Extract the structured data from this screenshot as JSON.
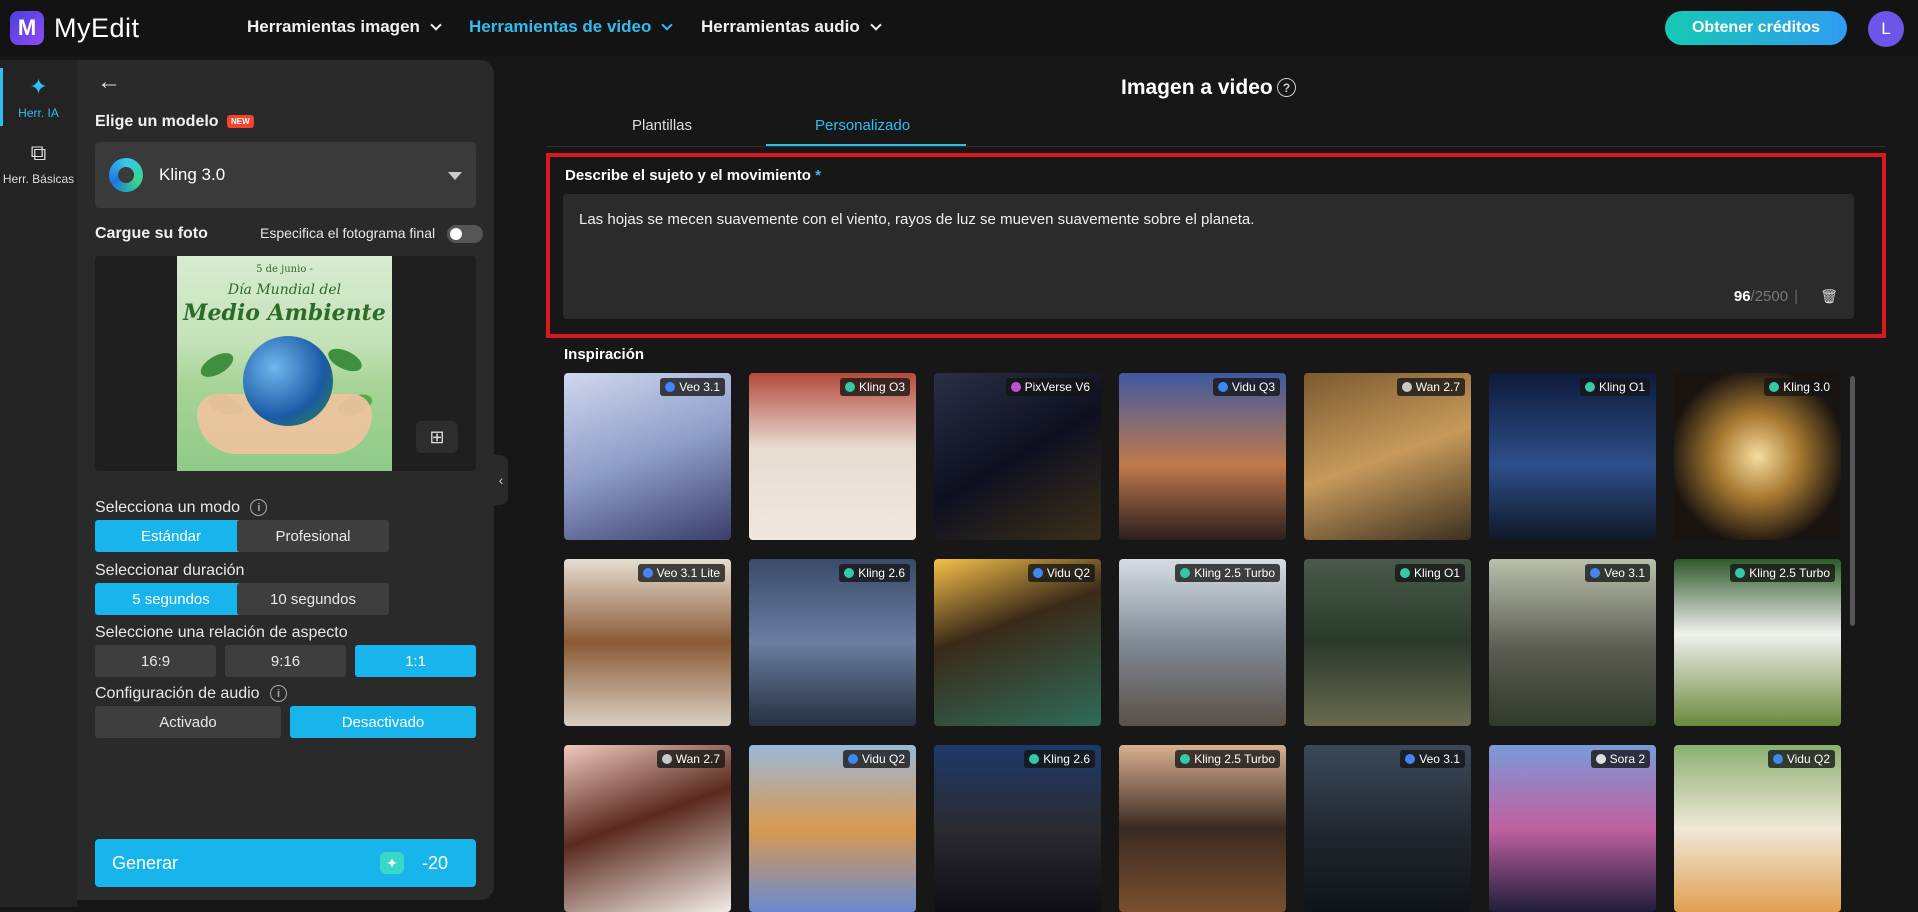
{
  "app": {
    "name": "MyEdit",
    "logo_letter": "M"
  },
  "nav": {
    "items": [
      {
        "label": "Herramientas imagen",
        "active": false
      },
      {
        "label": "Herramientas de video",
        "active": true
      },
      {
        "label": "Herramientas audio",
        "active": false
      }
    ],
    "credits_label": "Obtener créditos",
    "avatar_letter": "L"
  },
  "rail": {
    "items": [
      {
        "label": "Herr. IA",
        "icon": "magic-wand-icon",
        "active": true
      },
      {
        "label": "Herr. Básicas",
        "icon": "layers-icon",
        "active": false
      }
    ]
  },
  "panel": {
    "model_label": "Elige un modelo",
    "new_badge": "NEW",
    "model_selected": "Kling 3.0",
    "upload_label": "Cargue su foto",
    "final_frame_label": "Especifica el fotograma final",
    "photo_line1": "5 de junio -",
    "photo_line2": "Día Mundial del",
    "photo_line3": "Medio Ambiente",
    "mode_label": "Selecciona un modo",
    "modes": [
      "Estándar",
      "Profesional"
    ],
    "duration_label": "Seleccionar duración",
    "durations": [
      "5 segundos",
      "10 segundos"
    ],
    "aspect_label": "Seleccione una relación de aspecto",
    "aspects": [
      "16:9",
      "9:16",
      "1:1"
    ],
    "audio_label": "Configuración de audio",
    "audio_options": [
      "Activado",
      "Desactivado"
    ],
    "generate_label": "Generar",
    "generate_cost": "-20"
  },
  "main": {
    "title": "Imagen a video",
    "tabs": [
      "Plantillas",
      "Personalizado"
    ],
    "prompt_label": "Describe el sujeto y el movimiento",
    "prompt_required": "*",
    "prompt_text": "Las hojas se mecen suavemente con el viento, rayos de luz se mueven suavemente sobre el planeta.",
    "count_current": "96",
    "count_max": "/2500",
    "count_sep": "|",
    "inspiration_label": "Inspiración",
    "cards": [
      {
        "tag": "Veo 3.1",
        "bg": "linear-gradient(160deg,#cfd8ec,#8e9cc8 50%,#3a3e6a)"
      },
      {
        "tag": "Kling O3",
        "bg": "linear-gradient(180deg,#b54a3a,#e6dcd2 45%,#f0e8e0)"
      },
      {
        "tag": "PixVerse V6",
        "bg": "linear-gradient(150deg,#2a2f45,#0e1020 50%,#3b2f18)"
      },
      {
        "tag": "Vidu Q3",
        "bg": "linear-gradient(180deg,#3e5aa0,#c07a4a 55%,#2a1f1f)"
      },
      {
        "tag": "Wan 2.7",
        "bg": "linear-gradient(160deg,#7a5a30,#c79a5a 50%,#3b3020)"
      },
      {
        "tag": "Kling O1",
        "bg": "linear-gradient(180deg,#0e1a3a,#2c4f8a 55%,#101826)"
      },
      {
        "tag": "Kling 3.0",
        "bg": "radial-gradient(circle at 50% 50%,#f7dca0,#a87a30 35%,#1a1410 75%)"
      },
      {
        "tag": "Veo 3.1 Lite",
        "bg": "linear-gradient(180deg,#e6ddd0,#8a5a35 50%,#d8cfc2)"
      },
      {
        "tag": "Kling 2.6",
        "bg": "linear-gradient(180deg,#3a4a6a,#6a7ea0 50%,#283040)"
      },
      {
        "tag": "Vidu Q2",
        "bg": "linear-gradient(160deg,#f6c04a,#3a2a18 40%,#2f6b5a)"
      },
      {
        "tag": "Kling 2.5 Turbo",
        "bg": "linear-gradient(180deg,#d7dde3,#7f8a96 50%,#5a5048)"
      },
      {
        "tag": "Kling O1",
        "bg": "linear-gradient(180deg,#4a5a4a,#2a3a2a 50%,#6a6a50)"
      },
      {
        "tag": "Veo 3.1",
        "bg": "linear-gradient(180deg,#b8c0aa,#5a5a50 55%,#2f3a2a)"
      },
      {
        "tag": "Kling 2.5 Turbo",
        "bg": "linear-gradient(180deg,#2f5a2a,#f0f0ee 45%,#6a8a3a)"
      },
      {
        "tag": "Wan 2.7",
        "bg": "linear-gradient(160deg,#f0c8c0,#5a2a1e 45%,#f2ece6)"
      },
      {
        "tag": "Vidu Q2",
        "bg": "linear-gradient(180deg,#9ab8d8,#d89a50 50%,#6a8ad0)"
      },
      {
        "tag": "Kling 2.6",
        "bg": "linear-gradient(180deg,#1e3a6a,#2a2a30 50%,#0e0e14)"
      },
      {
        "tag": "Kling 2.5 Turbo",
        "bg": "linear-gradient(180deg,#d8b090,#3a2a20 50%,#7a5030)"
      },
      {
        "tag": "Veo 3.1",
        "bg": "linear-gradient(180deg,#3a4a5a,#20262e 55%,#101418)"
      },
      {
        "tag": "Sora 2",
        "bg": "linear-gradient(180deg,#7a9ad8,#c060a0 50%,#1e1e3a)"
      },
      {
        "tag": "Vidu Q2",
        "bg": "linear-gradient(180deg,#8ab070,#f0e8d8 50%,#e0a050)"
      }
    ]
  },
  "colors": {
    "accent": "#17b5ec",
    "highlight_border": "#d9191e",
    "credits_gradient": [
      "#16c9b4",
      "#2f9df2"
    ]
  }
}
